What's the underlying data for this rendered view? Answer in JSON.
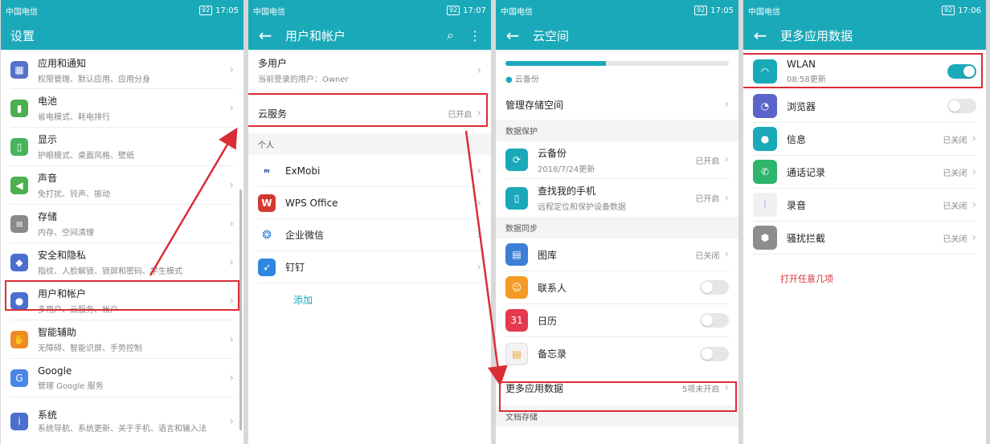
{
  "status_bars": [
    {
      "carrier": "中国电信",
      "time": "17:05",
      "battery": "92"
    },
    {
      "carrier": "中国电信",
      "time": "17:07",
      "battery": "92"
    },
    {
      "carrier": "中国电信",
      "time": "17:05",
      "battery": "92"
    },
    {
      "carrier": "中国电信",
      "time": "17:06",
      "battery": "92"
    }
  ],
  "panel1": {
    "title": "设置",
    "items": [
      {
        "title": "应用和通知",
        "sub": "权限管理、默认应用、应用分身"
      },
      {
        "title": "电池",
        "sub": "省电模式、耗电排行"
      },
      {
        "title": "显示",
        "sub": "护眼模式、桌面风格、壁纸"
      },
      {
        "title": "声音",
        "sub": "免打扰、铃声、振动"
      },
      {
        "title": "存储",
        "sub": "内存、空间清理"
      },
      {
        "title": "安全和隐私",
        "sub": "指纹、人脸解锁、锁屏和密码、学生模式"
      },
      {
        "title": "用户和帐户",
        "sub": "多用户、云服务、帐户"
      },
      {
        "title": "智能辅助",
        "sub": "无障碍、智能识屏、手势控制"
      },
      {
        "title": "Google",
        "sub": "管理 Google 服务"
      },
      {
        "title": "系统",
        "sub": "系统导航、系统更新、关于手机、语言和输入法"
      }
    ]
  },
  "panel2": {
    "title": "用户和帐户",
    "multi_user": {
      "title": "多用户",
      "sub": "当前登录的用户：Owner"
    },
    "cloud": {
      "title": "云服务",
      "status": "已开启"
    },
    "section_personal": "个人",
    "accounts": [
      {
        "name": "ExMobi",
        "logo_text": "ExMobi"
      },
      {
        "name": "WPS Office",
        "logo_text": "W"
      },
      {
        "name": "企业微信",
        "logo_text": ""
      },
      {
        "name": "钉钉",
        "logo_text": ""
      }
    ],
    "add_label": "添加"
  },
  "panel3": {
    "title": "云空间",
    "storage_progress": 0.45,
    "legend": "云备份",
    "manage": "管理存储空间",
    "section_protect": "数据保护",
    "backup": {
      "title": "云备份",
      "sub": "2018/7/24更新",
      "status": "已开启"
    },
    "find_phone": {
      "title": "查找我的手机",
      "sub": "远程定位和保护设备数据",
      "status": "已开启"
    },
    "section_sync": "数据同步",
    "sync_items": [
      {
        "title": "图库",
        "status": "已关闭",
        "kind": "text",
        "icon_text": ""
      },
      {
        "title": "联系人",
        "status": "",
        "kind": "toggle",
        "icon_text": ""
      },
      {
        "title": "日历",
        "status": "",
        "kind": "toggle",
        "icon_text": "31"
      },
      {
        "title": "备忘录",
        "status": "",
        "kind": "toggle",
        "icon_text": ""
      }
    ],
    "more": {
      "title": "更多应用数据",
      "status": "5项未开启"
    },
    "section_docs": "文档存储"
  },
  "panel4": {
    "title": "更多应用数据",
    "wlan": {
      "title": "WLAN",
      "sub": "08:58更新",
      "on": true
    },
    "browser": {
      "title": "浏览器",
      "on": false
    },
    "items": [
      {
        "title": "信息",
        "status": "已关闭"
      },
      {
        "title": "通话记录",
        "status": "已关闭"
      },
      {
        "title": "录音",
        "status": "已关闭"
      },
      {
        "title": "骚扰拦截",
        "status": "已关闭"
      }
    ],
    "annotation": "打开任意几项"
  },
  "colors": {
    "accent": "#1aa9b9",
    "highlight": "#d92e36"
  }
}
